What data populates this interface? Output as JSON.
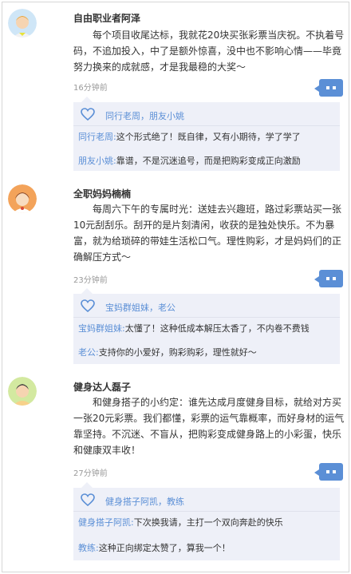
{
  "posts": [
    {
      "author": "自由职业者阿泽",
      "content": "每个项目收尾达标，我就花20块买张彩票当庆祝。不执着号码，不追加投入，中了是额外惊喜，没中也不影响心情——毕竟努力换来的成就感，才是我最稳的大奖～",
      "time": "16分钟前",
      "likes": "同行老周，朋友小姚",
      "replies": [
        {
          "who": "同行老周:",
          "text": "这个形式绝了！既自律，又有小期待，学了学了"
        },
        {
          "who": "朋友小姚:",
          "text": "靠谱，不是沉迷追号，而是把购彩变成正向激励"
        }
      ]
    },
    {
      "author": "全职妈妈楠楠",
      "content": "每周六下午的专属时光：送娃去兴趣班，路过彩票站买一张10元刮刮乐。刮开的是片刻清闲，收获的是独处快乐。不为暴富，就为给琐碎的带娃生活松口气。理性购彩，才是妈妈们的正确解压方式～",
      "time": "23分钟前",
      "likes": "宝妈群姐妹，老公",
      "replies": [
        {
          "who": "宝妈群姐妹:",
          "text": "太懂了！这种低成本解压太香了，不内卷不费钱"
        },
        {
          "who": "老公:",
          "text": "支持你的小爱好，购彩购彩，理性就好～"
        }
      ]
    },
    {
      "author": "健身达人磊子",
      "content": "和健身搭子的小约定：谁先达成月度健身目标，就给对方买一张20元彩票。我们都懂，彩票的运气靠概率，而好身材的运气靠坚持。不沉迷、不盲从，把购彩变成健身路上的小彩蛋，快乐和健康双丰收！",
      "time": "27分钟前",
      "likes": "健身搭子阿凯，教练",
      "replies": [
        {
          "who": "健身搭子阿凯:",
          "text": "下次换我请，主打一个双向奔赴的快乐"
        },
        {
          "who": "教练:",
          "text": "这种正向绑定太赞了，算我一个！"
        }
      ]
    }
  ],
  "colors": {
    "accent": "#5b8fd6",
    "reply_bg": "#eef0f8"
  },
  "icons": {
    "like": "heart-outline-icon",
    "comment": "comment-bubble-icon"
  }
}
